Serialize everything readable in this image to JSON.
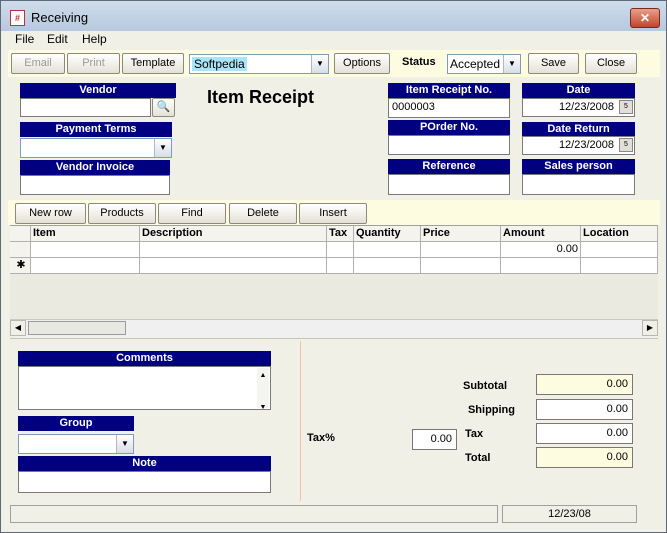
{
  "window": {
    "title": "Receiving",
    "icon_glyph": "#"
  },
  "menu": [
    "File",
    "Edit",
    "Help"
  ],
  "toolbar": {
    "email": "Email",
    "print": "Print",
    "template": "Template",
    "template_value": "Softpedia",
    "options": "Options",
    "status_label": "Status",
    "status_value": "Accepted",
    "save": "Save",
    "close": "Close"
  },
  "header": {
    "title": "Item Receipt",
    "vendor_label": "Vendor",
    "payment_terms_label": "Payment Terms",
    "vendor_invoice_label": "Vendor Invoice",
    "receipt_no_label": "Item Receipt No.",
    "receipt_no_value": "0000003",
    "porder_label": "POrder No.",
    "reference_label": "Reference",
    "date_label": "Date",
    "date_value": "12/23/2008",
    "date_return_label": "Date Return",
    "date_return_value": "12/23/2008",
    "salesperson_label": "Sales person"
  },
  "rowbar": {
    "new_row": "New row",
    "products": "Products",
    "find": "Find",
    "delete": "Delete",
    "insert": "Insert"
  },
  "grid": {
    "columns": [
      "Item",
      "Description",
      "Tax",
      "Quantity",
      "Price",
      "Amount",
      "Location"
    ],
    "rows": [
      {
        "item": "",
        "description": "",
        "tax": "",
        "quantity": "",
        "price": "",
        "amount": "0.00",
        "location": ""
      }
    ],
    "new_row_marker": "✱"
  },
  "footer": {
    "comments_label": "Comments",
    "group_label": "Group",
    "note_label": "Note",
    "tax_pct_label": "Tax%",
    "tax_pct_value": "0.00",
    "subtotal_label": "Subtotal",
    "subtotal_value": "0.00",
    "shipping_label": "Shipping",
    "shipping_value": "0.00",
    "tax_label": "Tax",
    "tax_value": "0.00",
    "total_label": "Total",
    "total_value": "0.00"
  },
  "statusbar": {
    "left": "",
    "date": "12/23/08"
  },
  "colors": {
    "label_bar": "#000080",
    "highlight": "#fdfbe0",
    "template_field": "#a9e4f8"
  }
}
